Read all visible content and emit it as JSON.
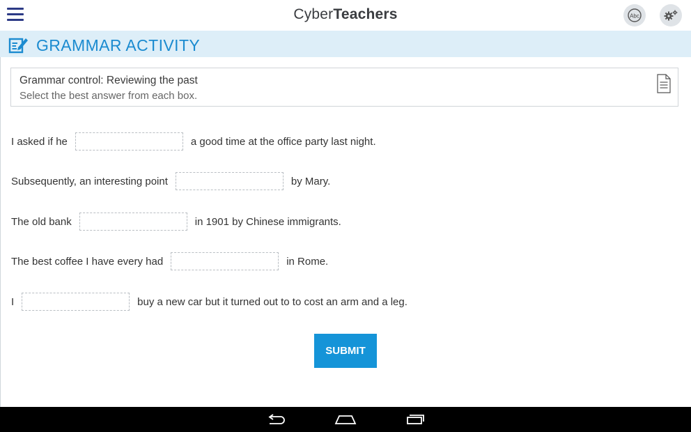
{
  "app": {
    "brand_part1": "Cyber",
    "brand_part2": "Teachers"
  },
  "header": {
    "menu_icon": "hamburger-icon",
    "spellcheck_icon": "abc-spellcheck-icon",
    "spellcheck_label": "Abc",
    "settings_icon": "gears-icon"
  },
  "activity": {
    "title": "GRAMMAR ACTIVITY",
    "title_icon": "edit-note-icon"
  },
  "instructions": {
    "title": "Grammar control:  Reviewing the past",
    "subtitle": "Select the best answer from each box.",
    "icon": "document-icon"
  },
  "sentences": [
    {
      "before": "I asked if he",
      "after": "a good time at the office party last night.",
      "answer": ""
    },
    {
      "before": "Subsequently, an interesting point",
      "after": "by Mary.",
      "answer": ""
    },
    {
      "before": "The old bank",
      "after": "in 1901 by Chinese immigrants.",
      "answer": ""
    },
    {
      "before": "The best coffee I have every had",
      "after": "in Rome.",
      "answer": ""
    },
    {
      "before": "I",
      "after": "buy a new car but it turned out to to cost an arm and a leg.",
      "answer": ""
    }
  ],
  "submit_label": "SUBMIT",
  "system_nav": {
    "back_icon": "back-icon",
    "home_icon": "home-icon",
    "recents_icon": "recent-apps-icon"
  },
  "colors": {
    "accent": "#1b8bd0",
    "button": "#1594d8",
    "title_band": "#ddeef8",
    "menu": "#2c3a86"
  }
}
